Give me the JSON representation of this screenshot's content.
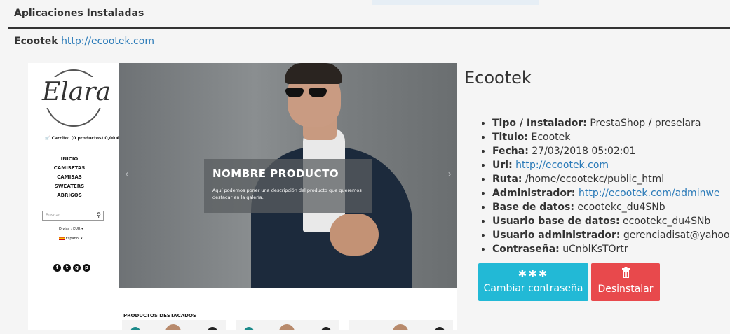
{
  "panel": {
    "title": "Aplicaciones Instaladas"
  },
  "app": {
    "name": "Ecootek",
    "url": "http://ecootek.com"
  },
  "preview": {
    "logo": "Elara",
    "cart": "Carrito: (0 productos) 0,00 €",
    "menu": [
      "INICIO",
      "CAMISETAS",
      "CAMISAS",
      "SWEATERS",
      "ABRIGOS"
    ],
    "search_placeholder": "Buscar",
    "currency": "Divisa : EUR",
    "language": "Español",
    "hero_title": "NOMBRE PRODUCTO",
    "hero_desc": "Aquí podemos poner una descripción del producto que queremos destacar en la galería.",
    "featured": "PRODUCTOS DESTACADOS"
  },
  "details": {
    "title": "Ecootek",
    "items": [
      {
        "label": "Tipo / Instalador:",
        "value": "PrestaShop / preselara"
      },
      {
        "label": "Titulo:",
        "value": "Ecootek"
      },
      {
        "label": "Fecha:",
        "value": "27/03/2018 05:02:01"
      },
      {
        "label": "Url:",
        "value": "http://ecootek.com"
      },
      {
        "label": "Ruta:",
        "value": "/home/ecootekc/public_html"
      },
      {
        "label": "Administrador:",
        "value": "http://ecootek.com/adminwe"
      },
      {
        "label": "Base de datos:",
        "value": "ecootekc_du4SNb"
      },
      {
        "label": "Usuario base de datos:",
        "value": "ecootekc_du4SNb"
      },
      {
        "label": "Usuario administrador:",
        "value": "gerenciadisat@yahoo.es"
      },
      {
        "label": "Contraseña:",
        "value": "uCnblKsTOrtr"
      }
    ]
  },
  "buttons": {
    "change_password": "Cambiar contraseña",
    "uninstall": "Desinstalar",
    "change_icon": "asterisks-icon",
    "uninstall_icon": "trash-icon",
    "change_color": "#22b9d6",
    "uninstall_color": "#e8494c"
  }
}
